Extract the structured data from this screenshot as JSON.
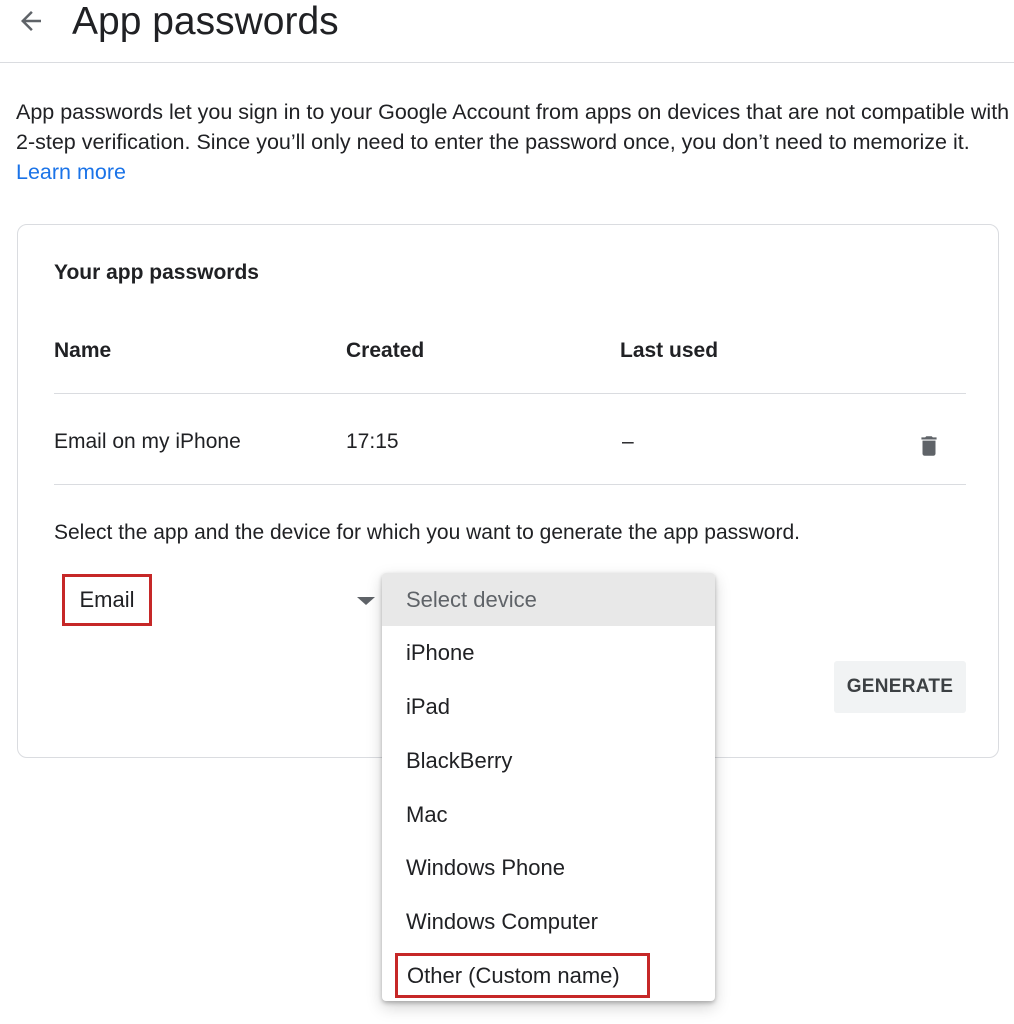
{
  "header": {
    "title": "App passwords",
    "back_icon": "arrow-back-icon"
  },
  "intro": {
    "text": "App passwords let you sign in to your Google Account from apps on devices that are not compatible with 2-step verification. Since you’ll only need to enter the password once, you don’t need to memorize it.",
    "learn_more": "Learn more"
  },
  "card": {
    "title": "Your app passwords",
    "columns": [
      "Name",
      "Created",
      "Last used"
    ],
    "rows": [
      {
        "name": "Email on my iPhone",
        "created": "17:15",
        "last_used": "–"
      }
    ],
    "select_prompt": "Select the app and the device for which you want to generate the app password.",
    "app_select_value": "Email",
    "generate_label": "GENERATE"
  },
  "device_dropdown": {
    "placeholder": "Select device",
    "options": [
      "iPhone",
      "iPad",
      "BlackBerry",
      "Mac",
      "Windows Phone",
      "Windows Computer",
      "Other (Custom name)"
    ]
  },
  "colors": {
    "link": "#1a73e8",
    "highlight_outline": "#c62828",
    "text": "#202124",
    "divider": "#dadce0"
  }
}
